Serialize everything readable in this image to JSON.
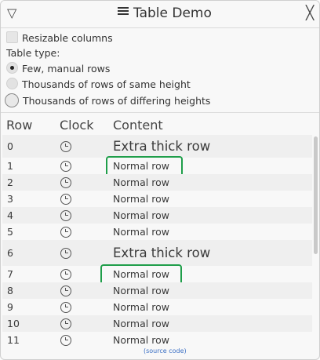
{
  "window": {
    "title": "Table Demo",
    "collapse_icon": "▽",
    "close_icon": "╳"
  },
  "options": {
    "resizable_columns": "Resizable columns",
    "table_type_label": "Table type:",
    "radio_few": "Few, manual rows",
    "radio_same": "Thousands of rows of same height",
    "radio_differing": "Thousands of rows of differing heights",
    "selected": "Few, manual rows"
  },
  "table": {
    "headers": {
      "row": "Row",
      "clock": "Clock",
      "content": "Content"
    },
    "rows": [
      {
        "row": "0",
        "content": "Extra thick row"
      },
      {
        "row": "1",
        "content": "Normal row"
      },
      {
        "row": "2",
        "content": "Normal row"
      },
      {
        "row": "3",
        "content": "Normal row"
      },
      {
        "row": "4",
        "content": "Normal row"
      },
      {
        "row": "5",
        "content": "Normal row"
      },
      {
        "row": "6",
        "content": "Extra thick row"
      },
      {
        "row": "7",
        "content": "Normal row"
      },
      {
        "row": "8",
        "content": "Normal row"
      },
      {
        "row": "9",
        "content": "Normal row"
      },
      {
        "row": "10",
        "content": "Normal row"
      },
      {
        "row": "11",
        "content": "Normal row"
      }
    ],
    "clock_icon": "clock-icon"
  },
  "footer": {
    "source_link": "(source code)"
  },
  "colors": {
    "highlight": "#1f9e4a",
    "link": "#3a6fc4"
  }
}
